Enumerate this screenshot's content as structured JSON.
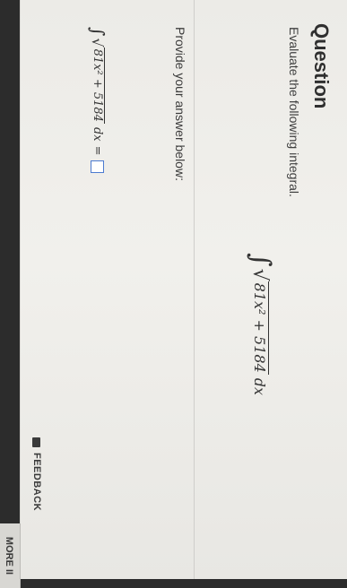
{
  "question": {
    "title": "Question",
    "prompt": "Evaluate the following integral."
  },
  "integral": {
    "radicand": "81x² + 5184",
    "differential": "dx"
  },
  "answer": {
    "label": "Provide your answer below:",
    "radicand": "81x² + 5184",
    "differential": "dx",
    "equals": "="
  },
  "footer": {
    "feedback_label": "FEEDBACK",
    "more_label": "MORE II"
  }
}
